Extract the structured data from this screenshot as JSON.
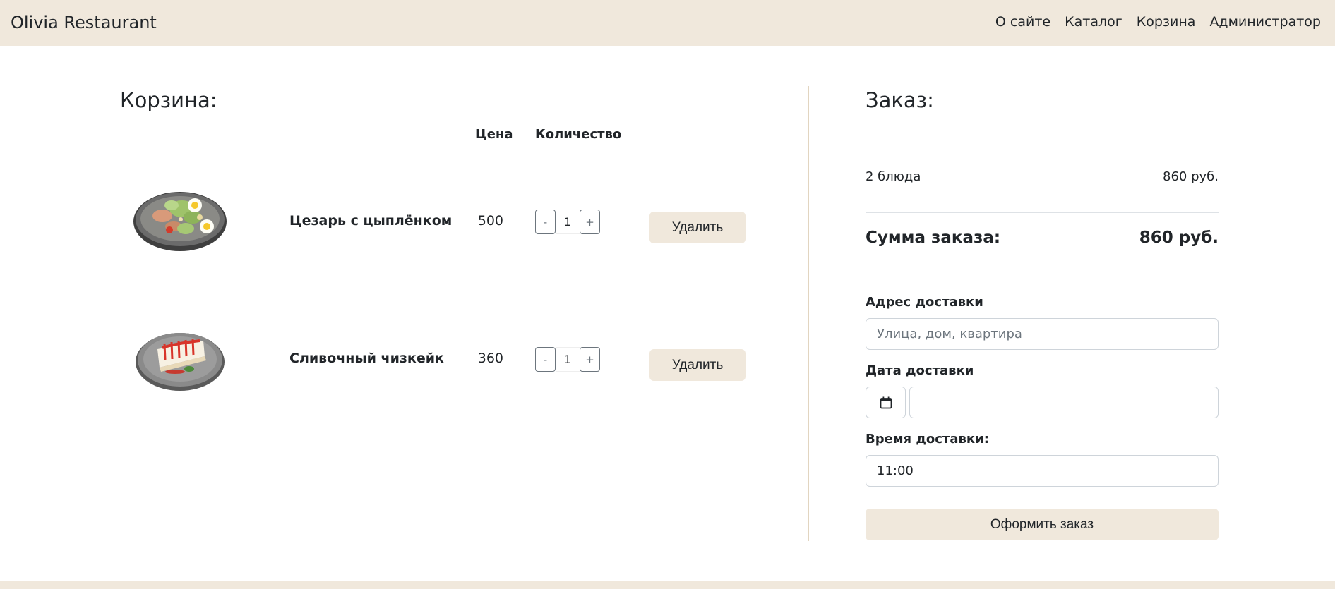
{
  "brand": "Olivia Restaurant",
  "nav": {
    "about": "О сайте",
    "catalog": "Каталог",
    "cart": "Корзина",
    "admin": "Администратор"
  },
  "cart": {
    "title": "Корзина:",
    "col_price": "Цена",
    "col_qty": "Количество",
    "items": [
      {
        "name": "Цезарь с цыплёнком",
        "price": "500",
        "qty": "1",
        "minus": "-",
        "plus": "+",
        "delete": "Удалить",
        "image": "caesar-salad"
      },
      {
        "name": "Сливочный чизкейк",
        "price": "360",
        "qty": "1",
        "minus": "-",
        "plus": "+",
        "delete": "Удалить",
        "image": "cheesecake"
      }
    ]
  },
  "order": {
    "title": "Заказ:",
    "dishes_count": "2 блюда",
    "dishes_sum": "860 руб.",
    "total_label": "Сумма заказа:",
    "total_value": "860 руб.",
    "address_label": "Адрес доставки",
    "address_placeholder": "Улица, дом, квартира",
    "date_label": "Дата доставки",
    "time_label": "Время доставки:",
    "time_value": "11:00",
    "submit": "Оформить заказ"
  },
  "colors": {
    "accent": "#f0e8dc",
    "divider": "#dee2e6"
  }
}
